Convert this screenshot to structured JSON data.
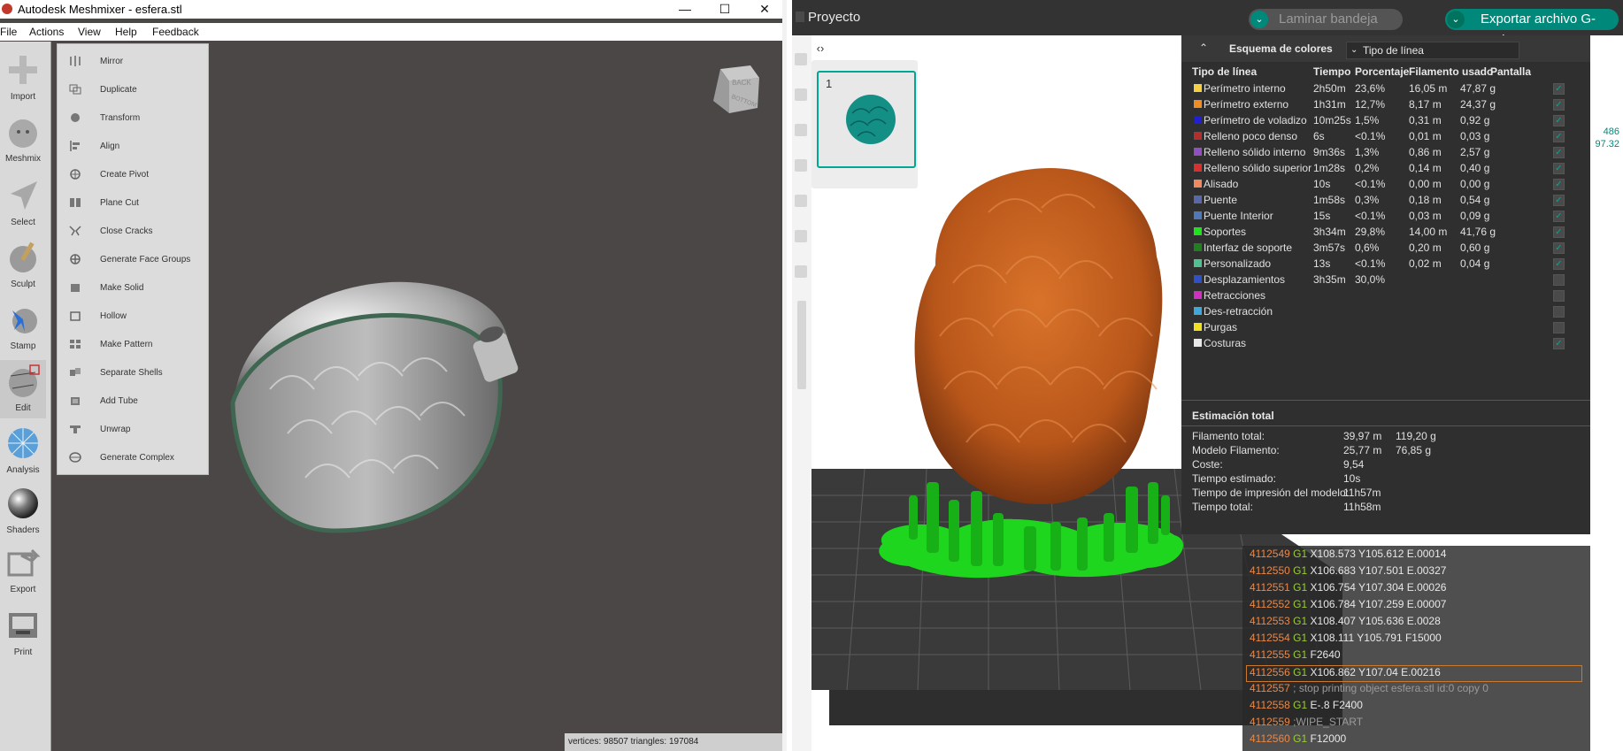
{
  "meshmixer": {
    "title": "Autodesk Meshmixer - esfera.stl",
    "window_buttons": [
      "—",
      "☐",
      "✕"
    ],
    "menu": [
      "File",
      "Actions",
      "View",
      "Help",
      "Feedback"
    ],
    "toolbar": [
      "Import",
      "Meshmix",
      "Select",
      "Sculpt",
      "Stamp",
      "Edit",
      "Analysis",
      "Shaders",
      "Export",
      "Print"
    ],
    "edit_menu": [
      "Mirror",
      "Duplicate",
      "Transform",
      "Align",
      "Create Pivot",
      "Plane Cut",
      "Close Cracks",
      "Generate Face Groups",
      "Make Solid",
      "Hollow",
      "Make Pattern",
      "Separate Shells",
      "Add Tube",
      "Unwrap",
      "Generate Complex"
    ],
    "cube_labels": [
      "BACK",
      "BOTTOM"
    ],
    "status": "vertices: 98507 triangles: 197084"
  },
  "slicer": {
    "project_label": "Proyecto",
    "btn_laminar": "Laminar bandeja",
    "btn_export": "Exportar archivo G-Code",
    "collapse_icon": "‹›",
    "plate_number": "1",
    "side_values": [
      "486",
      "97.32"
    ],
    "legend": {
      "title": "Esquema de colores",
      "selector": "Tipo de línea",
      "columns": [
        "Tipo de línea",
        "Tiempo",
        "Porcentaje",
        "Filamento usado",
        "Pantalla"
      ],
      "rows": [
        {
          "name": "Perímetro interno",
          "color": "#f5d040",
          "time": "2h50m",
          "pct": "23,6%",
          "len": "16,05 m",
          "weight": "47,87 g",
          "checked": true
        },
        {
          "name": "Perímetro externo",
          "color": "#f08c28",
          "time": "1h31m",
          "pct": "12,7%",
          "len": "8,17 m",
          "weight": "24,37 g",
          "checked": true
        },
        {
          "name": "Perímetro de voladizo",
          "color": "#2020d0",
          "time": "10m25s",
          "pct": "1,5%",
          "len": "0,31 m",
          "weight": "0,92 g",
          "checked": true
        },
        {
          "name": "Relleno poco denso",
          "color": "#b03030",
          "time": "6s",
          "pct": "<0.1%",
          "len": "0,01 m",
          "weight": "0,03 g",
          "checked": true
        },
        {
          "name": "Relleno sólido interno",
          "color": "#9050c0",
          "time": "9m36s",
          "pct": "1,3%",
          "len": "0,86 m",
          "weight": "2,57 g",
          "checked": true
        },
        {
          "name": "Relleno sólido superior",
          "color": "#d83030",
          "time": "1m28s",
          "pct": "0,2%",
          "len": "0,14 m",
          "weight": "0,40 g",
          "checked": true
        },
        {
          "name": "Alisado",
          "color": "#f08860",
          "time": "10s",
          "pct": "<0.1%",
          "len": "0,00 m",
          "weight": "0,00 g",
          "checked": true
        },
        {
          "name": "Puente",
          "color": "#5868a8",
          "time": "1m58s",
          "pct": "0,3%",
          "len": "0,18 m",
          "weight": "0,54 g",
          "checked": true
        },
        {
          "name": "Puente Interior",
          "color": "#5078b8",
          "time": "15s",
          "pct": "<0.1%",
          "len": "0,03 m",
          "weight": "0,09 g",
          "checked": true
        },
        {
          "name": "Soportes",
          "color": "#20e020",
          "time": "3h34m",
          "pct": "29,8%",
          "len": "14,00 m",
          "weight": "41,76 g",
          "checked": true
        },
        {
          "name": "Interfaz de soporte",
          "color": "#208020",
          "time": "3m57s",
          "pct": "0,6%",
          "len": "0,20 m",
          "weight": "0,60 g",
          "checked": true
        },
        {
          "name": "Personalizado",
          "color": "#50c090",
          "time": "13s",
          "pct": "<0.1%",
          "len": "0,02 m",
          "weight": "0,04 g",
          "checked": true
        },
        {
          "name": "Desplazamientos",
          "color": "#3050c8",
          "time": "3h35m",
          "pct": "30,0%",
          "len": "",
          "weight": "",
          "checked": false
        },
        {
          "name": "Retracciones",
          "color": "#d030c0",
          "time": "",
          "pct": "",
          "len": "",
          "weight": "",
          "checked": false
        },
        {
          "name": "Des-retracción",
          "color": "#40a8d8",
          "time": "",
          "pct": "",
          "len": "",
          "weight": "",
          "checked": false
        },
        {
          "name": "Purgas",
          "color": "#f0e020",
          "time": "",
          "pct": "",
          "len": "",
          "weight": "",
          "checked": false
        },
        {
          "name": "Costuras",
          "color": "#e8e8e8",
          "time": "",
          "pct": "",
          "len": "",
          "weight": "",
          "checked": true
        }
      ],
      "estimation_title": "Estimación total",
      "estimation": [
        {
          "label": "Filamento total:",
          "v1": "39,97 m",
          "v2": "119,20 g"
        },
        {
          "label": "Modelo Filamento:",
          "v1": "25,77 m",
          "v2": "76,85 g"
        },
        {
          "label": "Coste:",
          "v1": "9,54",
          "v2": ""
        },
        {
          "label": "Tiempo estimado:",
          "v1": "10s",
          "v2": ""
        },
        {
          "label": "Tiempo de impresión del modelo:",
          "v1": "11h57m",
          "v2": ""
        },
        {
          "label": "Tiempo total:",
          "v1": "11h58m",
          "v2": ""
        }
      ]
    },
    "gcode": [
      {
        "ln": "4112549",
        "cmd": "G1",
        "args": "X108.573 Y105.612 E.00014"
      },
      {
        "ln": "4112550",
        "cmd": "G1",
        "args": "X106.683 Y107.501 E.00327"
      },
      {
        "ln": "4112551",
        "cmd": "G1",
        "args": "X106.754 Y107.304 E.00026"
      },
      {
        "ln": "4112552",
        "cmd": "G1",
        "args": "X106.784 Y107.259 E.00007"
      },
      {
        "ln": "4112553",
        "cmd": "G1",
        "args": "X108.407 Y105.636 E.0028"
      },
      {
        "ln": "4112554",
        "cmd": "G1",
        "args": "X108.111 Y105.791 F15000"
      },
      {
        "ln": "4112555",
        "cmd": "G1",
        "args": "F2640"
      },
      {
        "ln": "4112556",
        "cmd": "G1",
        "args": "X106.862 Y107.04 E.00216"
      },
      {
        "ln": "4112557",
        "cmd": "",
        "args": "; stop printing object esfera.stl id:0 copy 0"
      },
      {
        "ln": "4112558",
        "cmd": "G1",
        "args": "E-.8 F2400"
      },
      {
        "ln": "4112559",
        "cmd": "",
        "args": ";WIPE_START"
      },
      {
        "ln": "4112560",
        "cmd": "G1",
        "args": "F12000"
      }
    ]
  }
}
